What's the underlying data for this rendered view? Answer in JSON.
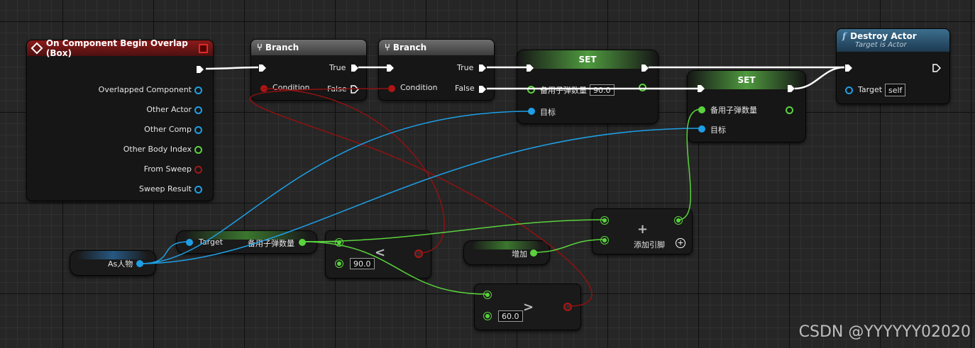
{
  "colors": {
    "exec": "#ffffff",
    "object": "#1e9fe5",
    "integer": "#5ad33d",
    "boolean": "#b01414",
    "event_header": "#8c1a1a",
    "function_header": "#3c6e8f"
  },
  "event": {
    "title": "On Component Begin Overlap (Box)",
    "pins": [
      "Overlapped Component",
      "Other Actor",
      "Other Comp",
      "Other Body Index",
      "From Sweep",
      "Sweep Result"
    ]
  },
  "branch1": {
    "title": "Branch",
    "condition": "Condition",
    "true_label": "True",
    "false_label": "False"
  },
  "branch2": {
    "title": "Branch",
    "condition": "Condition",
    "true_label": "True",
    "false_label": "False"
  },
  "set1": {
    "title": "SET",
    "var_label": "备用子弹数量",
    "value": "90.0",
    "target_label": "目标"
  },
  "set2": {
    "title": "SET",
    "var_label": "备用子弹数量",
    "target_label": "目标"
  },
  "destroy": {
    "title": "Destroy Actor",
    "subtitle": "Target is Actor",
    "target_label": "Target",
    "target_value": "self"
  },
  "cast": {
    "label": "As人物"
  },
  "getter": {
    "target_label": "Target",
    "var_label": "备用子弹数量"
  },
  "less": {
    "symbol": "<",
    "value": "90.0"
  },
  "greater": {
    "symbol": ">",
    "value": "60.0"
  },
  "add_var": {
    "label": "增加"
  },
  "add": {
    "symbol": "+",
    "add_pin": "添加引脚"
  },
  "watermark": "CSDN @YYYYYY02020"
}
